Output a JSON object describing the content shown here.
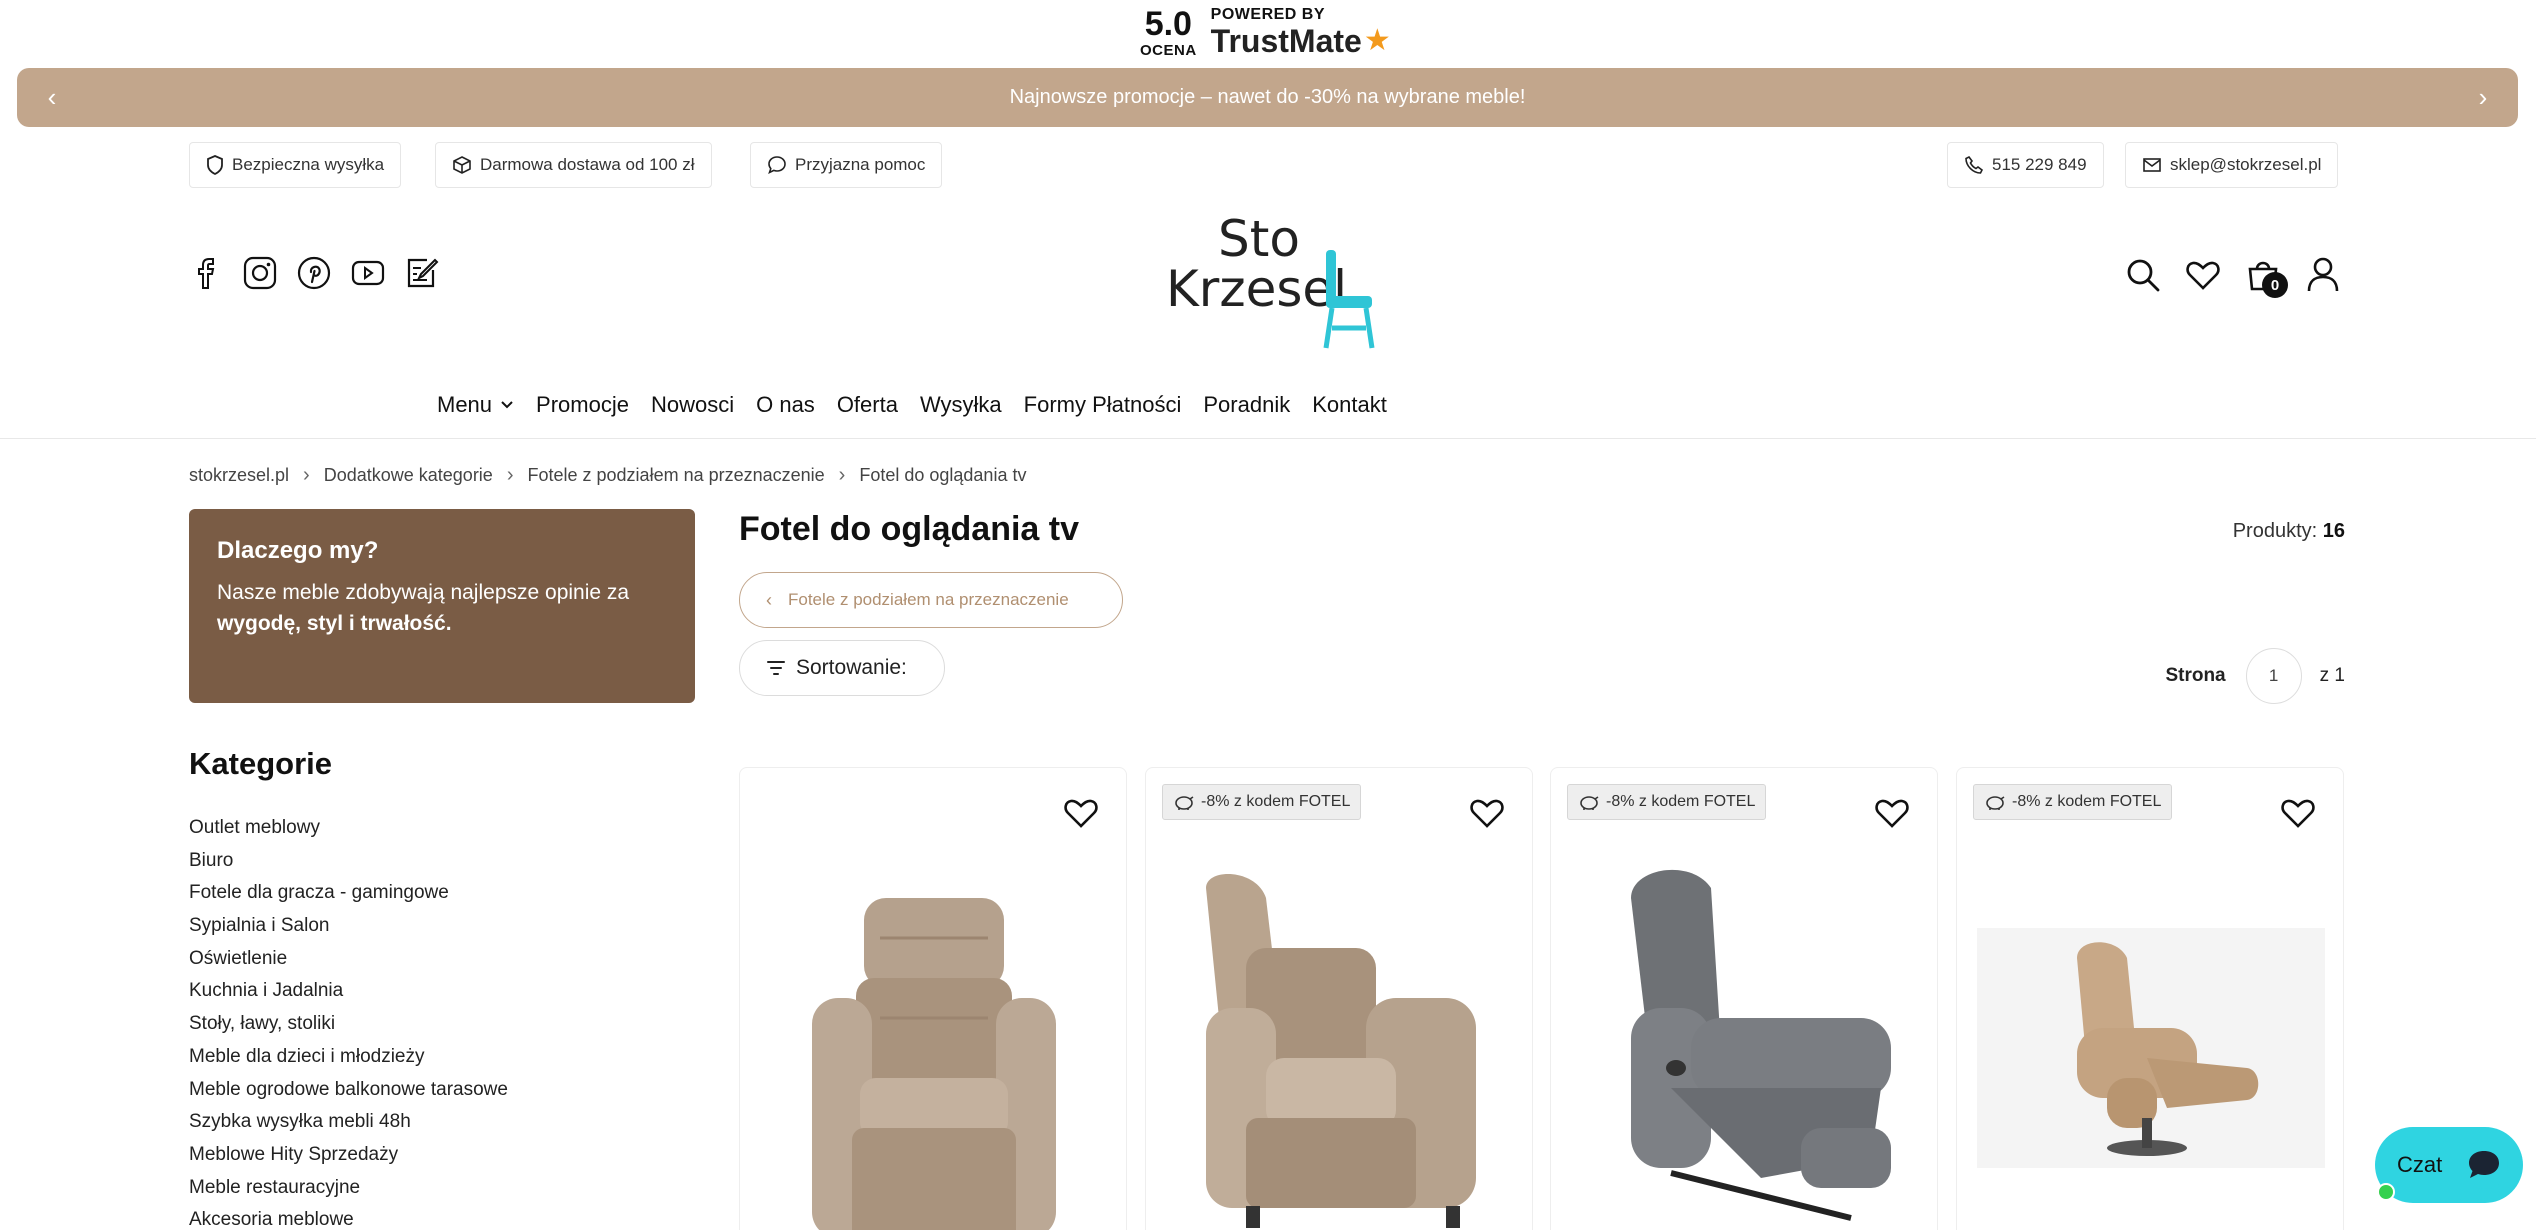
{
  "trustmate": {
    "score": "5.0",
    "score_label": "OCENA",
    "powered_by": "POWERED BY",
    "brand": "TrustMate"
  },
  "promo": {
    "text": "Najnowsze promocje – nawet do -30% na wybrane meble!",
    "prev": "‹",
    "next": "›"
  },
  "info_chips": {
    "shipping": "Bezpieczna wysyłka",
    "delivery": "Darmowa dostawa od 100 zł",
    "help": "Przyjazna pomoc",
    "phone": "515 229 849",
    "email": "sklep@stokrzesel.pl"
  },
  "logo": {
    "line1": "Sto",
    "line2": "Krzesel",
    "accent": "#2fc5d6"
  },
  "cart": {
    "count": "0"
  },
  "nav": [
    "Menu",
    "Promocje",
    "Nowosci",
    "O nas",
    "Oferta",
    "Wysyłka",
    "Formy Płatności",
    "Poradnik",
    "Kontakt"
  ],
  "breadcrumb": [
    "stokrzesel.pl",
    "Dodatkowe kategorie",
    "Fotele z podziałem na przeznaczenie",
    "Fotel do oglądania tv"
  ],
  "why": {
    "title": "Dlaczego my?",
    "text": "Nasze meble zdobywają najlepsze opinie za",
    "bold": "wygodę, styl i trwałość."
  },
  "categories": {
    "title": "Kategorie",
    "items": [
      "Outlet meblowy",
      "Biuro",
      "Fotele dla gracza - gamingowe",
      "Sypialnia i Salon",
      "Oświetlenie",
      "Kuchnia i Jadalnia",
      "Stoły, ławy, stoliki",
      "Meble dla dzieci i młodzieży",
      "Meble ogrodowe balkonowe tarasowe",
      "Szybka wysyłka mebli 48h",
      "Meblowe Hity Sprzedaży",
      "Meble restauracyjne",
      "Akcesoria meblowe"
    ]
  },
  "main": {
    "title": "Fotel do oglądania tv",
    "products_label": "Produkty:",
    "products_count": "16",
    "back_label": "Fotele z podziałem na przeznaczenie",
    "sort_label": "Sortowanie:",
    "page_label": "Strona",
    "page_current": "1",
    "page_total": "z 1"
  },
  "products": [
    {
      "badge": "",
      "color": "beige"
    },
    {
      "badge": "-8% z kodem FOTEL",
      "color": "beige"
    },
    {
      "badge": "-8% z kodem FOTEL",
      "color": "grey"
    },
    {
      "badge": "-8% z kodem FOTEL",
      "color": "tan"
    }
  ],
  "chat": {
    "label": "Czat"
  },
  "colors": {
    "promo_bg": "#c2a68c",
    "why_bg": "#7a5c45",
    "chat_bg": "#2fd4e1"
  }
}
